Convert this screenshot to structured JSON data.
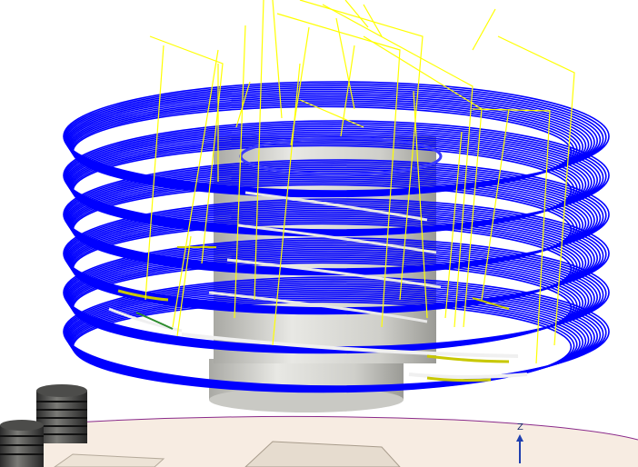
{
  "viewport": {
    "axis_label": "Z"
  },
  "scene": {
    "background_color": "#ffffff",
    "toolpath_color": "#0000ff",
    "link_move_color": "#ffff00",
    "part_color": "#d9d9d4",
    "stock_color": "#f7ece2",
    "triad_color": "#1f3fb0",
    "highlight_color": "#c8c800",
    "cutting_passes": 6,
    "link_moves": 26
  }
}
